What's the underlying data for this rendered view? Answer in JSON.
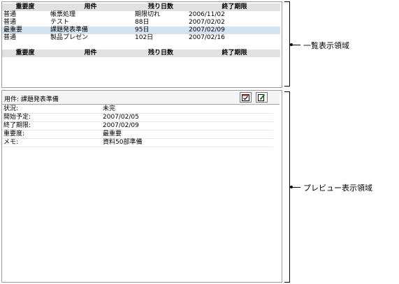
{
  "list": {
    "columns": [
      "重要度",
      "用件",
      "残り日数",
      "終了期限"
    ],
    "rows": [
      {
        "priority": "普通",
        "task": "帳票処理",
        "remaining": "期限切れ",
        "due": "2006/11/02"
      },
      {
        "priority": "普通",
        "task": "テスト",
        "remaining": "88日",
        "due": "2007/02/02"
      },
      {
        "priority": "最重要",
        "task": "課題発表準備",
        "remaining": "95日",
        "due": "2007/02/09"
      },
      {
        "priority": "普通",
        "task": "製品プレゼン",
        "remaining": "102日",
        "due": "2007/02/16"
      }
    ],
    "selected_index": 2
  },
  "preview": {
    "title": "用件: 課題発表準備",
    "fields": [
      {
        "label": "状況:",
        "value": "未完"
      },
      {
        "label": "開始予定:",
        "value": "2007/02/05"
      },
      {
        "label": "終了期限:",
        "value": "2007/02/09"
      },
      {
        "label": "重要度:",
        "value": "最重要"
      },
      {
        "label": "メモ:",
        "value": "資料50部準備"
      }
    ],
    "buttons": [
      {
        "icon": "calendar-check-icon"
      },
      {
        "icon": "edit-note-icon"
      }
    ]
  },
  "annotations": {
    "list_area": "一覧表示領域",
    "preview_area": "プレビュー表示領域"
  }
}
